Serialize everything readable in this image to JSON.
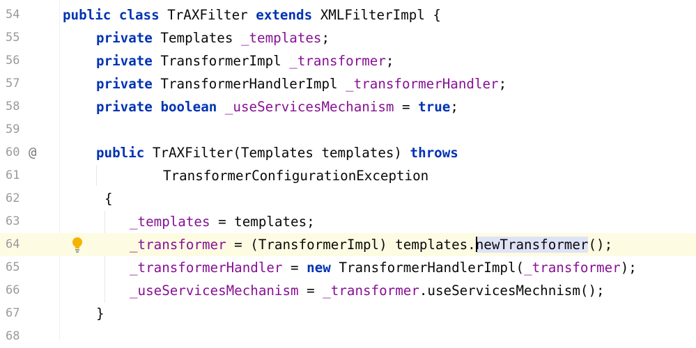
{
  "editor": {
    "lines": [
      {
        "num": "54",
        "segments": [
          {
            "t": "public",
            "c": "kw"
          },
          {
            "t": " "
          },
          {
            "t": "class",
            "c": "kw"
          },
          {
            "t": " TrAXFilter "
          },
          {
            "t": "extends",
            "c": "kw"
          },
          {
            "t": " XMLFilterImpl {"
          }
        ]
      },
      {
        "num": "55",
        "segments": [
          {
            "t": "private",
            "c": "kw"
          },
          {
            "t": " Templates "
          },
          {
            "t": "_templates",
            "c": "fld"
          },
          {
            "t": ";"
          }
        ]
      },
      {
        "num": "56",
        "segments": [
          {
            "t": "private",
            "c": "kw"
          },
          {
            "t": " TransformerImpl "
          },
          {
            "t": "_transformer",
            "c": "fld"
          },
          {
            "t": ";"
          }
        ]
      },
      {
        "num": "57",
        "segments": [
          {
            "t": "private",
            "c": "kw"
          },
          {
            "t": " TransformerHandlerImpl "
          },
          {
            "t": "_transformerHandler",
            "c": "fld"
          },
          {
            "t": ";"
          }
        ]
      },
      {
        "num": "58",
        "segments": [
          {
            "t": "private",
            "c": "kw"
          },
          {
            "t": " "
          },
          {
            "t": "boolean",
            "c": "kw"
          },
          {
            "t": " "
          },
          {
            "t": "_useServicesMechanism",
            "c": "fld"
          },
          {
            "t": " = "
          },
          {
            "t": "true",
            "c": "kw"
          },
          {
            "t": ";"
          }
        ]
      },
      {
        "num": "59",
        "segments": []
      },
      {
        "num": "60",
        "gutter": "@",
        "segments": [
          {
            "t": "public",
            "c": "kw"
          },
          {
            "t": " TrAXFilter(Templates templates) "
          },
          {
            "t": "throws",
            "c": "kw"
          }
        ]
      },
      {
        "num": "61",
        "segments": [
          {
            "t": "TransformerConfigurationException"
          }
        ]
      },
      {
        "num": "62",
        "segments": [
          {
            "t": "{"
          }
        ]
      },
      {
        "num": "63",
        "segments": [
          {
            "t": "_templates",
            "c": "fld"
          },
          {
            "t": " = templates;"
          }
        ]
      },
      {
        "num": "64",
        "current": true,
        "bulb": true,
        "segments": [
          {
            "t": "_transformer",
            "c": "fld"
          },
          {
            "t": " = (TransformerImpl) templates."
          },
          {
            "t": "",
            "c": "caret"
          },
          {
            "t": "newTransformer",
            "c": "mhl"
          },
          {
            "t": "();"
          }
        ]
      },
      {
        "num": "65",
        "segments": [
          {
            "t": "_transformerHandler",
            "c": "fld"
          },
          {
            "t": " = "
          },
          {
            "t": "new",
            "c": "kw"
          },
          {
            "t": " TransformerHandlerImpl("
          },
          {
            "t": "_transformer",
            "c": "fld"
          },
          {
            "t": ");"
          }
        ]
      },
      {
        "num": "66",
        "segments": [
          {
            "t": "_useServicesMechanism",
            "c": "fld"
          },
          {
            "t": " = "
          },
          {
            "t": "_transformer",
            "c": "fld"
          },
          {
            "t": ".useServicesMechnism();"
          }
        ]
      },
      {
        "num": "67",
        "segments": [
          {
            "t": "}"
          }
        ]
      },
      {
        "num": "68",
        "segments": []
      }
    ]
  }
}
